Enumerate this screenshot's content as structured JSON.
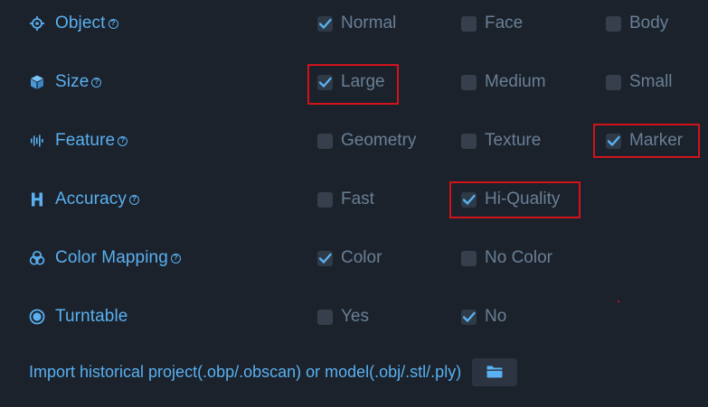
{
  "colors": {
    "background": "#1b222c",
    "label": "#5ab0f0",
    "option_text": "#6a7f95",
    "checkbox_bg": "#363f4b",
    "check": "#5ab0f0",
    "highlight": "#d2131a"
  },
  "rows": [
    {
      "label": "Object",
      "icon": "target-icon",
      "help": true,
      "options": [
        {
          "label": "Normal",
          "checked": true
        },
        {
          "label": "Face",
          "checked": false
        },
        {
          "label": "Body",
          "checked": false
        }
      ]
    },
    {
      "label": "Size",
      "icon": "cube-icon",
      "help": true,
      "options": [
        {
          "label": "Large",
          "checked": true,
          "highlighted": true
        },
        {
          "label": "Medium",
          "checked": false
        },
        {
          "label": "Small",
          "checked": false
        }
      ]
    },
    {
      "label": "Feature",
      "icon": "waveform-icon",
      "help": true,
      "options": [
        {
          "label": "Geometry",
          "checked": false
        },
        {
          "label": "Texture",
          "checked": false
        },
        {
          "label": "Marker",
          "checked": true,
          "highlighted": true
        }
      ]
    },
    {
      "label": "Accuracy",
      "icon": "h-letter-icon",
      "help": true,
      "options": [
        {
          "label": "Fast",
          "checked": false
        },
        {
          "label": "Hi-Quality",
          "checked": true,
          "highlighted": true
        }
      ]
    },
    {
      "label": "Color Mapping",
      "icon": "color-circles-icon",
      "help": true,
      "options": [
        {
          "label": "Color",
          "checked": true
        },
        {
          "label": "No Color",
          "checked": false
        }
      ]
    },
    {
      "label": "Turntable",
      "icon": "turntable-icon",
      "help": false,
      "options": [
        {
          "label": "Yes",
          "checked": false
        },
        {
          "label": "No",
          "checked": true
        }
      ]
    }
  ],
  "import": {
    "label": "Import historical project(.obp/.obscan) or model(.obj/.stl/.ply)",
    "button_icon": "folder-icon"
  }
}
